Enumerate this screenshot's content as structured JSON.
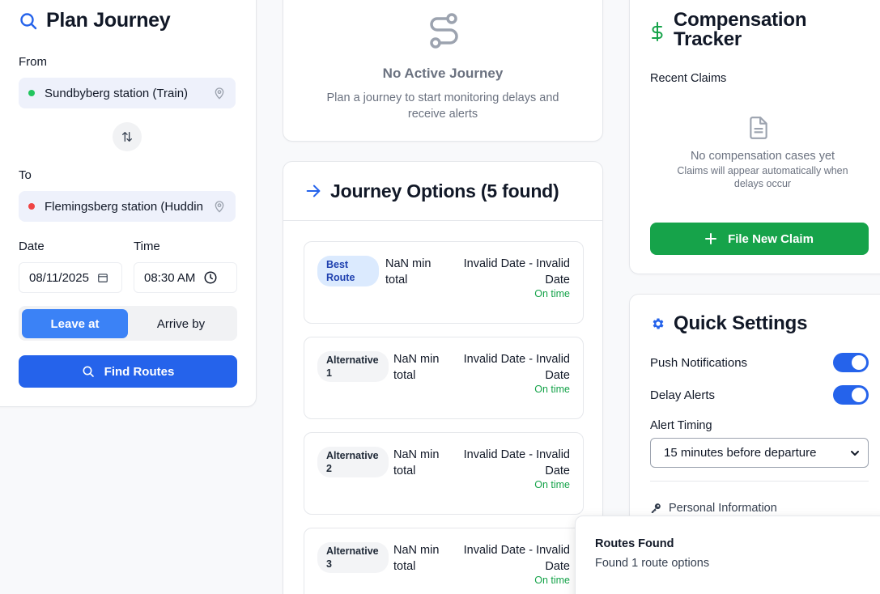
{
  "plan": {
    "title": "Plan Journey",
    "from_label": "From",
    "from_value": "Sundbyberg station (Train)",
    "to_label": "To",
    "to_value": "Flemingsberg station (Huddin",
    "date_label": "Date",
    "date_value": "08/11/2025",
    "time_label": "Time",
    "time_value": "08:30 AM",
    "leave_at": "Leave at",
    "arrive_by": "Arrive by",
    "find_routes": "Find Routes",
    "colors": {
      "from_dot": "#22c55e",
      "to_dot": "#ef4444",
      "accent": "#2563eb"
    }
  },
  "no_active": {
    "title": "No Active Journey",
    "subtitle": "Plan a journey to start monitoring delays and receive alerts"
  },
  "options": {
    "title": "Journey Options (5 found)",
    "routes": [
      {
        "badge": "Best Route",
        "duration": "NaN min total",
        "time": "Invalid Date - Invalid Date",
        "status": "On time"
      },
      {
        "badge": "Alternative 1",
        "duration": "NaN min total",
        "time": "Invalid Date - Invalid Date",
        "status": "On time"
      },
      {
        "badge": "Alternative 2",
        "duration": "NaN min total",
        "time": "Invalid Date - Invalid Date",
        "status": "On time"
      },
      {
        "badge": "Alternative 3",
        "duration": "NaN min total",
        "time": "Invalid Date - Invalid Date",
        "status": "On time"
      }
    ]
  },
  "compensation": {
    "title": "Compensation Tracker",
    "recent": "Recent Claims",
    "empty_main": "No compensation cases yet",
    "empty_sub": "Claims will appear automatically when delays occur",
    "file_claim": "File New Claim"
  },
  "settings": {
    "title": "Quick Settings",
    "push": "Push Notifications",
    "push_on": true,
    "delay": "Delay Alerts",
    "delay_on": true,
    "alert_timing": "Alert Timing",
    "alert_value": "15 minutes before departure",
    "personal": "Personal Information"
  },
  "toast": {
    "title": "Routes Found",
    "message": "Found 1 route options"
  }
}
